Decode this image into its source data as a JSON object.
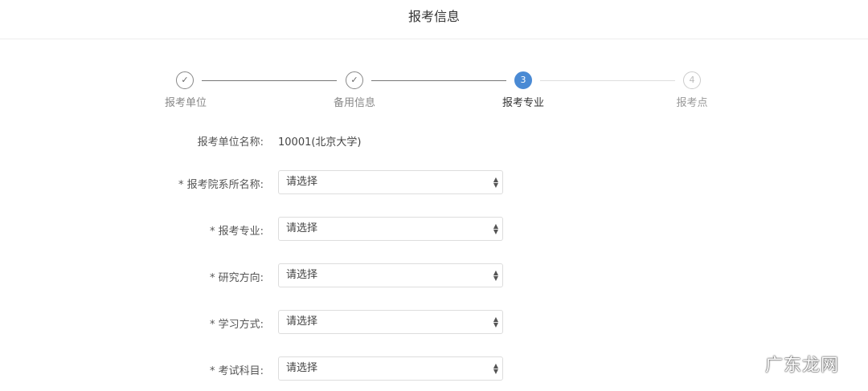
{
  "header": {
    "title": "报考信息"
  },
  "steps": [
    {
      "num": "✓",
      "label": "报考单位",
      "state": "done"
    },
    {
      "num": "✓",
      "label": "备用信息",
      "state": "done"
    },
    {
      "num": "3",
      "label": "报考专业",
      "state": "active"
    },
    {
      "num": "4",
      "label": "报考点",
      "state": "pending"
    }
  ],
  "colors": {
    "accent": "#4a8ad4"
  },
  "form": {
    "unit_label": "报考单位名称:",
    "unit_value": "10001(北京大学)",
    "fields": [
      {
        "label": "* 报考院系所名称:",
        "value": "请选择"
      },
      {
        "label": "* 报考专业:",
        "value": "请选择"
      },
      {
        "label": "* 研究方向:",
        "value": "请选择"
      },
      {
        "label": "* 学习方式:",
        "value": "请选择"
      },
      {
        "label": "* 考试科目:",
        "value": "请选择"
      }
    ]
  },
  "watermark": "广东龙网"
}
